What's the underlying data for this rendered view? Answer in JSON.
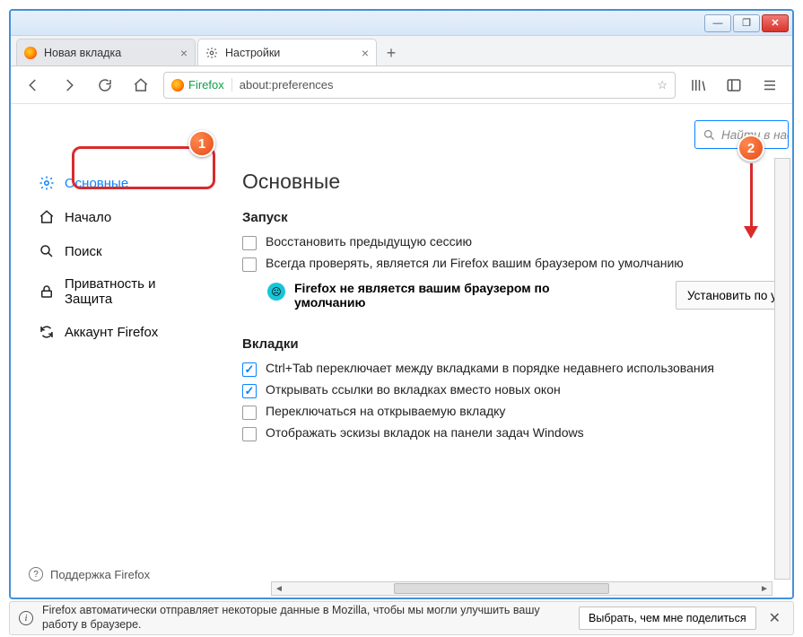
{
  "window": {
    "min": "—",
    "max": "❐",
    "close": "✕"
  },
  "tabs": [
    {
      "title": "Новая вкладка",
      "active": false
    },
    {
      "title": "Настройки",
      "active": true
    }
  ],
  "urlbar": {
    "identity": "Firefox",
    "url": "about:preferences"
  },
  "sidebar": {
    "items": [
      {
        "key": "general",
        "label": "Основные",
        "active": true
      },
      {
        "key": "home",
        "label": "Начало",
        "active": false
      },
      {
        "key": "search",
        "label": "Поиск",
        "active": false
      },
      {
        "key": "privacy",
        "label": "Приватность и Защита",
        "active": false
      },
      {
        "key": "account",
        "label": "Аккаунт Firefox",
        "active": false
      }
    ],
    "support": "Поддержка Firefox"
  },
  "main": {
    "search_placeholder": "Найти в настройках",
    "heading": "Основные",
    "startup": {
      "title": "Запуск",
      "restore": {
        "label": "Восстановить предыдущую сессию",
        "checked": false
      },
      "always_check": {
        "label": "Всегда проверять, является ли Firefox вашим браузером по умолчанию",
        "checked": false
      },
      "not_default_msg": "Firefox не является вашим браузером по умолчанию",
      "set_default_btn": "Установить по умолчанию"
    },
    "tabs_section": {
      "title": "Вкладки",
      "ctrl_tab": {
        "label": "Ctrl+Tab переключает между вкладками в порядке недавнего использования",
        "checked": true
      },
      "open_links": {
        "label": "Открывать ссылки во вкладках вместо новых окон",
        "checked": true
      },
      "switch_to": {
        "label": "Переключаться на открываемую вкладку",
        "checked": false
      },
      "taskbar_previews": {
        "label": "Отображать эскизы вкладок на панели задач Windows",
        "checked": false
      }
    }
  },
  "notif": {
    "msg": "Firefox автоматически отправляет некоторые данные в Mozilla, чтобы мы могли улучшить вашу работу в браузере.",
    "btn": "Выбрать, чем мне поделиться"
  },
  "annotations": {
    "c1": "1",
    "c2": "2"
  }
}
